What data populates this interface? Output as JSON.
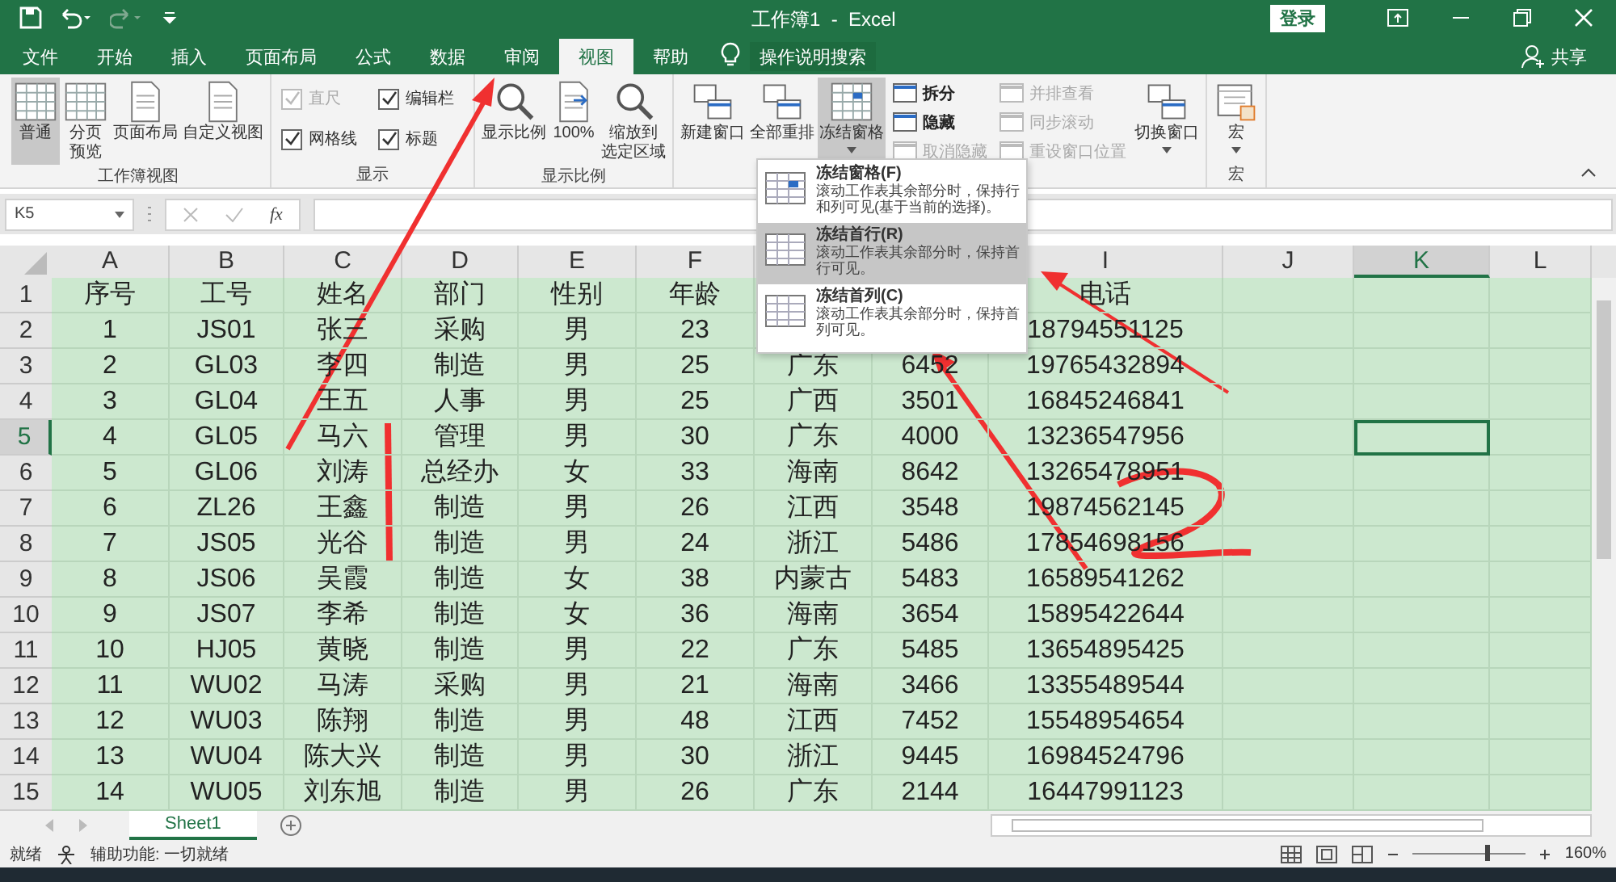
{
  "title_bar": {
    "title": "工作簿1  -  Excel",
    "login": "登录"
  },
  "menu_tabs": [
    {
      "label": "文件",
      "selected": false
    },
    {
      "label": "开始",
      "selected": false
    },
    {
      "label": "插入",
      "selected": false
    },
    {
      "label": "页面布局",
      "selected": false
    },
    {
      "label": "公式",
      "selected": false
    },
    {
      "label": "数据",
      "selected": false
    },
    {
      "label": "审阅",
      "selected": false
    },
    {
      "label": "视图",
      "selected": true
    },
    {
      "label": "帮助",
      "selected": false
    }
  ],
  "tell_me": "操作说明搜索",
  "share": "共享",
  "ribbon": {
    "groups": [
      {
        "label": "工作簿视图",
        "columns": [
          [
            {
              "kind": "large",
              "label": [
                "普通"
              ],
              "selected": true,
              "dropdown": false
            }
          ],
          [
            {
              "kind": "large",
              "label": [
                "分页",
                "预览"
              ],
              "selected": false,
              "dropdown": false
            }
          ],
          [
            {
              "kind": "large",
              "label": [
                "页面布局"
              ],
              "selected": false,
              "dropdown": false
            }
          ],
          [
            {
              "kind": "large",
              "label": [
                "自定义视图"
              ],
              "selected": false,
              "dropdown": false
            }
          ]
        ]
      },
      {
        "label": "显示",
        "columns": [
          [
            {
              "kind": "check",
              "label": "直尺",
              "checked": true,
              "disabled": true
            },
            {
              "kind": "check",
              "label": "网格线",
              "checked": true,
              "disabled": false
            }
          ],
          [
            {
              "kind": "check",
              "label": "编辑栏",
              "checked": true,
              "disabled": false
            },
            {
              "kind": "check",
              "label": "标题",
              "checked": true,
              "disabled": false
            }
          ]
        ]
      },
      {
        "label": "显示比例",
        "columns": [
          [
            {
              "kind": "large",
              "label": [
                "显示比例"
              ],
              "selected": false,
              "dropdown": false
            }
          ],
          [
            {
              "kind": "large",
              "label": [
                "100%"
              ],
              "selected": false,
              "dropdown": false
            }
          ],
          [
            {
              "kind": "large",
              "label": [
                "缩放到",
                "选定区域"
              ],
              "selected": false,
              "dropdown": false
            }
          ]
        ]
      },
      {
        "columns": [
          [
            {
              "kind": "large",
              "label": [
                "新建窗口"
              ],
              "selected": false,
              "dropdown": false
            }
          ],
          [
            {
              "kind": "large",
              "label": [
                "全部重排"
              ],
              "selected": false,
              "dropdown": false
            }
          ],
          [
            {
              "kind": "large",
              "label": [
                "冻结窗格"
              ],
              "selected": true,
              "dropdown": true
            }
          ],
          [
            {
              "kind": "small",
              "label": "拆分",
              "disabled": false
            },
            {
              "kind": "small",
              "label": "隐藏",
              "disabled": false
            },
            {
              "kind": "small",
              "label": "取消隐藏",
              "disabled": true
            }
          ],
          [
            {
              "kind": "small",
              "label": "并排查看",
              "disabled": true
            },
            {
              "kind": "small",
              "label": "同步滚动",
              "disabled": true
            },
            {
              "kind": "small",
              "label": "重设窗口位置",
              "disabled": true
            }
          ],
          [
            {
              "kind": "large",
              "label": [
                "切换窗口"
              ],
              "selected": false,
              "dropdown": true
            }
          ]
        ]
      },
      {
        "label": "宏",
        "columns": [
          [
            {
              "kind": "large",
              "label": [
                "宏"
              ],
              "selected": false,
              "dropdown": true
            }
          ]
        ]
      }
    ]
  },
  "freeze_menu": [
    {
      "title": "冻结窗格(F)",
      "description": "滚动工作表其余部分时，保持行和列可见(基于当前的选择)。",
      "selected": false
    },
    {
      "title": "冻结首行(R)",
      "description": "滚动工作表其余部分时，保持首行可见。",
      "selected": true
    },
    {
      "title": "冻结首列(C)",
      "description": "滚动工作表其余部分时，保持首列可见。",
      "selected": false
    }
  ],
  "formula_bar": {
    "name_box": "K5",
    "fx": "fx"
  },
  "columns": [
    {
      "letter": "A",
      "selected": false
    },
    {
      "letter": "B",
      "selected": false
    },
    {
      "letter": "C",
      "selected": false
    },
    {
      "letter": "D",
      "selected": false
    },
    {
      "letter": "E",
      "selected": false
    },
    {
      "letter": "F",
      "selected": false
    },
    {
      "letter": "I",
      "selected": false
    },
    {
      "letter": "J",
      "selected": false
    },
    {
      "letter": "K",
      "selected": true
    },
    {
      "letter": "L",
      "selected": false
    }
  ],
  "rows": [
    {
      "number": "1",
      "selected": false,
      "cells": [
        "序号",
        "工号",
        "姓名",
        "部门",
        "性别",
        "年龄",
        null,
        null,
        "电话"
      ]
    },
    {
      "number": "2",
      "selected": false,
      "cells": [
        "1",
        "JS01",
        "张三",
        "采购",
        "男",
        "23",
        null,
        null,
        "18794551125"
      ]
    },
    {
      "number": "3",
      "selected": false,
      "cells": [
        "2",
        "GL03",
        "李四",
        "制造",
        "男",
        "25",
        "广东",
        "6452",
        "19765432894"
      ]
    },
    {
      "number": "4",
      "selected": false,
      "cells": [
        "3",
        "GL04",
        "王五",
        "人事",
        "男",
        "25",
        "广西",
        "3501",
        "16845246841"
      ]
    },
    {
      "number": "5",
      "selected": true,
      "cells": [
        "4",
        "GL05",
        "马六",
        "管理",
        "男",
        "30",
        "广东",
        "4000",
        "13236547956"
      ]
    },
    {
      "number": "6",
      "selected": false,
      "cells": [
        "5",
        "GL06",
        "刘涛",
        "总经办",
        "女",
        "33",
        "海南",
        "8642",
        "13265478951"
      ]
    },
    {
      "number": "7",
      "selected": false,
      "cells": [
        "6",
        "ZL26",
        "王鑫",
        "制造",
        "男",
        "26",
        "江西",
        "3548",
        "19874562145"
      ]
    },
    {
      "number": "8",
      "selected": false,
      "cells": [
        "7",
        "JS05",
        "光谷",
        "制造",
        "男",
        "24",
        "浙江",
        "5486",
        "17854698156"
      ]
    },
    {
      "number": "9",
      "selected": false,
      "cells": [
        "8",
        "JS06",
        "吴霞",
        "制造",
        "女",
        "38",
        "内蒙古",
        "5483",
        "16589541262"
      ]
    },
    {
      "number": "10",
      "selected": false,
      "cells": [
        "9",
        "JS07",
        "李希",
        "制造",
        "女",
        "36",
        "海南",
        "3654",
        "15895422644"
      ]
    },
    {
      "number": "11",
      "selected": false,
      "cells": [
        "10",
        "HJ05",
        "黄晓",
        "制造",
        "男",
        "22",
        "广东",
        "5485",
        "13654895425"
      ]
    },
    {
      "number": "12",
      "selected": false,
      "cells": [
        "11",
        "WU02",
        "马涛",
        "采购",
        "男",
        "21",
        "海南",
        "3466",
        "13355489544"
      ]
    },
    {
      "number": "13",
      "selected": false,
      "cells": [
        "12",
        "WU03",
        "陈翔",
        "制造",
        "男",
        "48",
        "江西",
        "7452",
        "15548954654"
      ]
    },
    {
      "number": "14",
      "selected": false,
      "cells": [
        "13",
        "WU04",
        "陈大兴",
        "制造",
        "男",
        "30",
        "浙江",
        "9445",
        "16984524796"
      ]
    },
    {
      "number": "15",
      "selected": false,
      "cells": [
        "14",
        "WU05",
        "刘东旭",
        "制造",
        "男",
        "26",
        "广东",
        "2144",
        "16447991123"
      ]
    }
  ],
  "sheets": [
    {
      "label": "Sheet1",
      "selected": true
    }
  ],
  "status_bar": {
    "ready": "就绪",
    "accessibility": "辅助功能: 一切就绪",
    "zoom": "160%",
    "level": 0.63
  }
}
